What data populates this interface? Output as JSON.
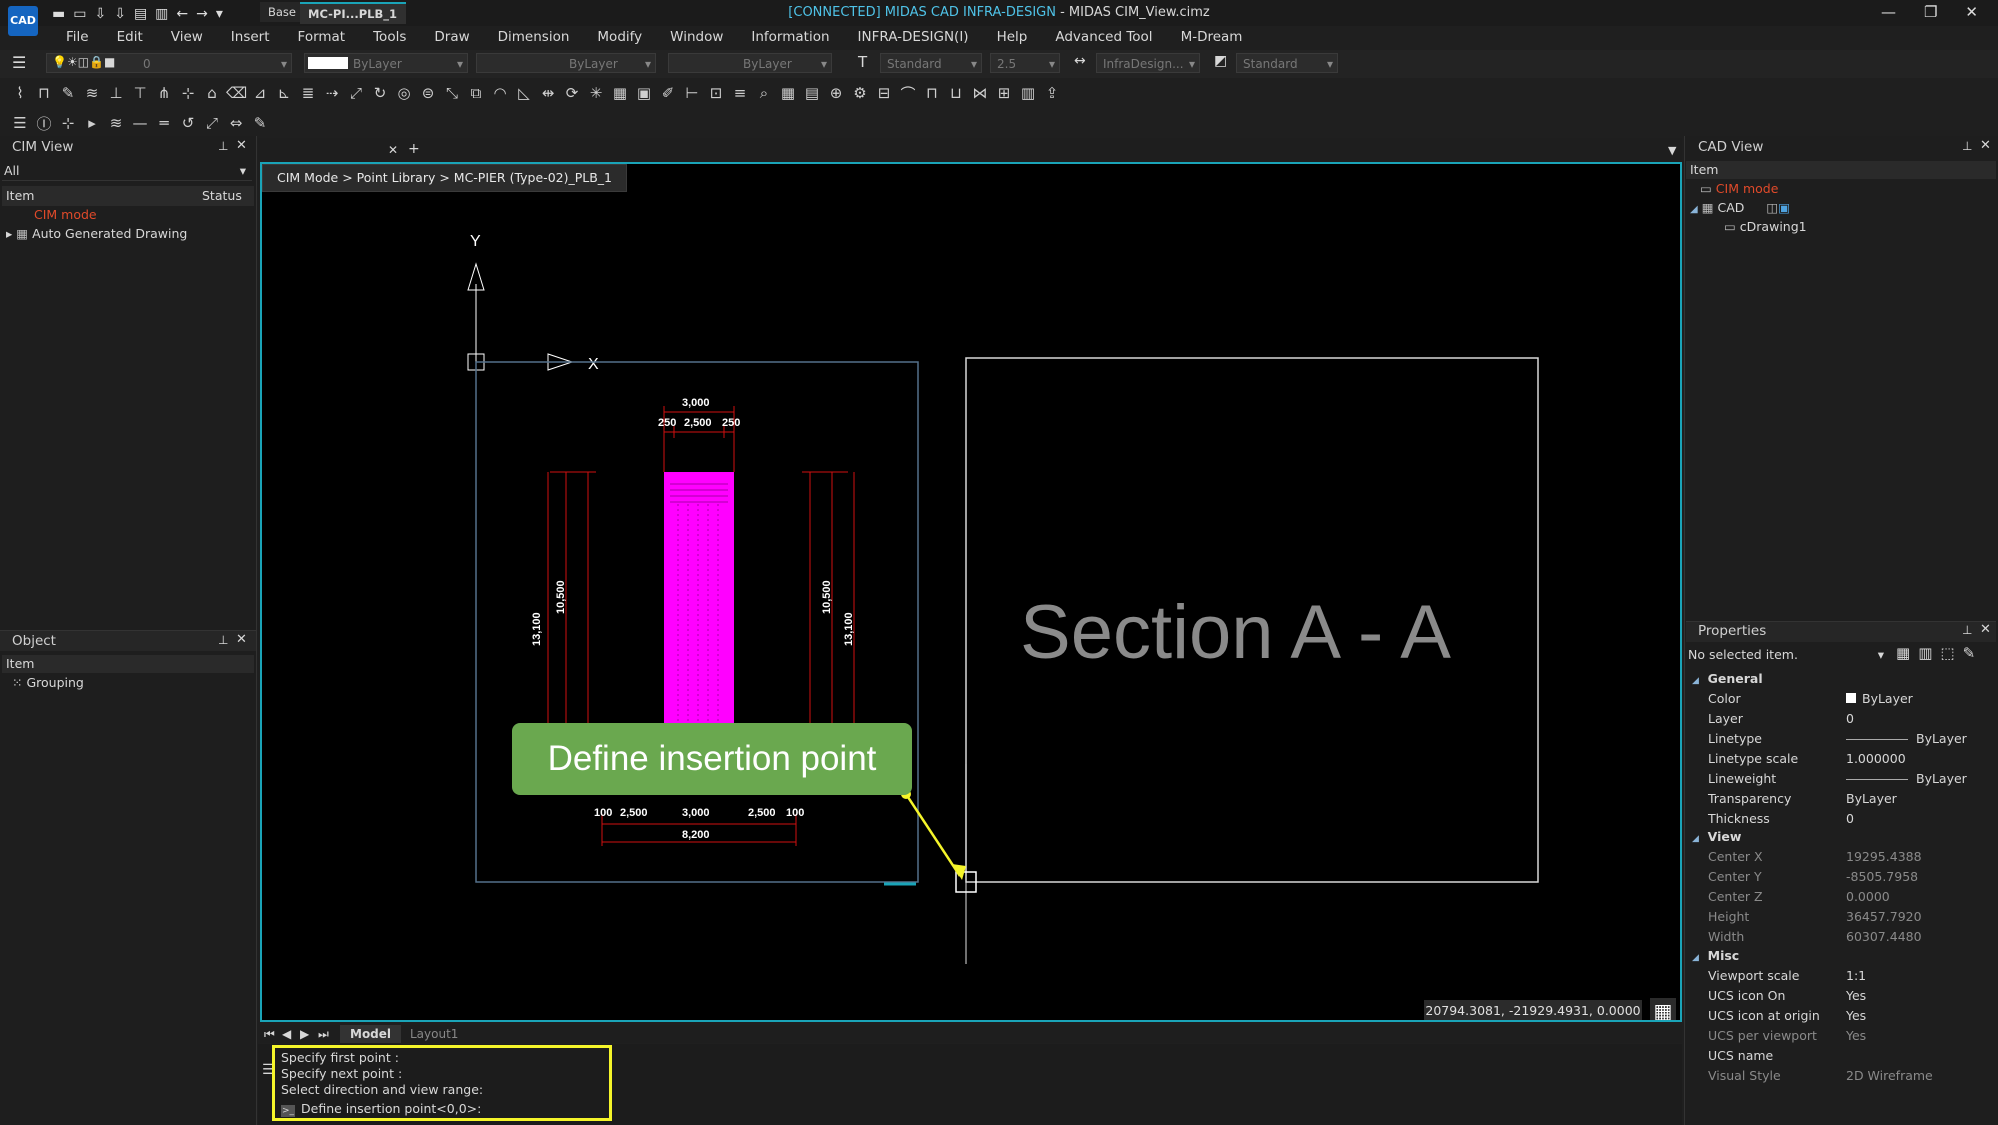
{
  "app": {
    "title_connected": "[CONNECTED] MIDAS CAD INFRA-DESIGN",
    "title_file": " - MIDAS CIM_View.cimz",
    "logo": "CAD",
    "window_controls": [
      "—",
      "❐",
      "✕"
    ]
  },
  "menu": [
    "File",
    "Edit",
    "View",
    "Insert",
    "Format",
    "Tools",
    "Draw",
    "Dimension",
    "Modify",
    "Window",
    "Information",
    "INFRA-DESIGN(I)",
    "Help",
    "Advanced Tool",
    "M-Dream"
  ],
  "toolbar": {
    "layer_value": "0",
    "color_value": "ByLayer",
    "linetype_value": "ByLayer",
    "lineweight_value": "ByLayer",
    "textstyle_value": "Standard",
    "textheight_value": "2.5",
    "dimstyle_value": "InfraDesign...",
    "tablestyle_value": "Standard"
  },
  "left_panel": {
    "cim_view_title": "CIM View",
    "filter": "All",
    "col_item": "Item",
    "col_status": "Status",
    "items": [
      "CIM mode",
      "Auto Generated Drawing"
    ],
    "object_title": "Object",
    "object_col_item": "Item",
    "object_items": [
      "Grouping"
    ]
  },
  "tabs": [
    "Base",
    "MC-PI...PLB_1"
  ],
  "breadcrumb": "CIM Mode > Point Library > MC-PIER (Type-02)_PLB_1",
  "viewport": {
    "axis_y": "Y",
    "axis_x": "X",
    "section_label": "Section A - A",
    "callout": "Define insertion point",
    "dims": {
      "top_total": "3,000",
      "top_a": "250",
      "top_b": "2,500",
      "top_c": "250",
      "left_outer": "13,100",
      "left_inner": "10,500",
      "right_inner": "10,500",
      "right_outer": "13,100",
      "bot_a": "100",
      "bot_b": "2,500",
      "bot_c": "3,000",
      "bot_d": "2,500",
      "bot_e": "100",
      "bot_total": "8,200"
    },
    "coords": "20794.3081, -21929.4931, 0.0000"
  },
  "layout_tabs": [
    "Model",
    "Layout1"
  ],
  "command": {
    "lines": [
      "Specify first point :",
      "Specify next point :",
      "Select direction and view range:"
    ],
    "prompt": "Define insertion point<0,0>:"
  },
  "right_panel": {
    "cad_view_title": "CAD View",
    "col_item": "Item",
    "tree": [
      "CIM mode",
      "CAD",
      "cDrawing1"
    ],
    "properties_title": "Properties",
    "selection": "No selected item.",
    "groups": {
      "general": "General",
      "view": "View",
      "misc": "Misc"
    },
    "general_rows": [
      {
        "label": "Color",
        "value": "ByLayer"
      },
      {
        "label": "Layer",
        "value": "0"
      },
      {
        "label": "Linetype",
        "value": "ByLayer"
      },
      {
        "label": "Linetype scale",
        "value": "1.000000"
      },
      {
        "label": "Lineweight",
        "value": "ByLayer"
      },
      {
        "label": "Transparency",
        "value": "ByLayer"
      },
      {
        "label": "Thickness",
        "value": "0"
      }
    ],
    "view_rows": [
      {
        "label": "Center X",
        "value": "19295.4388"
      },
      {
        "label": "Center Y",
        "value": "-8505.7958"
      },
      {
        "label": "Center Z",
        "value": "0.0000"
      },
      {
        "label": "Height",
        "value": "36457.7920"
      },
      {
        "label": "Width",
        "value": "60307.4480"
      }
    ],
    "misc_rows": [
      {
        "label": "Viewport scale",
        "value": "1:1"
      },
      {
        "label": "UCS icon On",
        "value": "Yes"
      },
      {
        "label": "UCS icon at origin",
        "value": "Yes"
      },
      {
        "label": "UCS per viewport",
        "value": "Yes"
      },
      {
        "label": "UCS name",
        "value": ""
      },
      {
        "label": "Visual Style",
        "value": "2D Wireframe"
      }
    ]
  },
  "colors": {
    "accent": "#1aa4b8",
    "callout": "#6aa84f",
    "highlight": "#f5f52a",
    "pier": "#ff00ff",
    "cim_mode": "#e04a2a"
  }
}
